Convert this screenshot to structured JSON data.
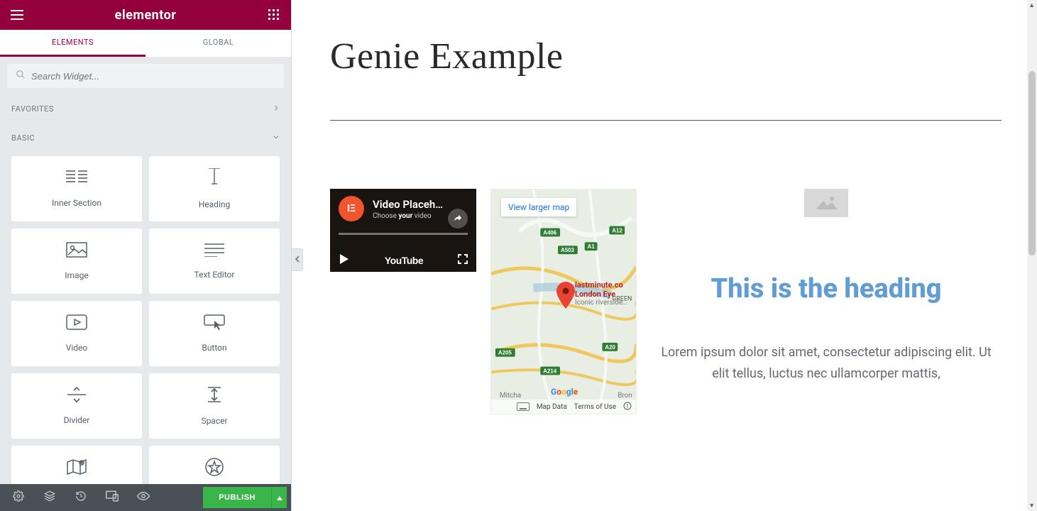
{
  "brand": "elementor",
  "tabs": {
    "elements": "ELEMENTS",
    "global": "GLOBAL"
  },
  "search": {
    "placeholder": "Search Widget..."
  },
  "sections": {
    "favorites": "FAVORITES",
    "basic": "BASIC"
  },
  "widgets": [
    {
      "name": "inner-section",
      "label": "Inner Section"
    },
    {
      "name": "heading",
      "label": "Heading"
    },
    {
      "name": "image",
      "label": "Image"
    },
    {
      "name": "text-editor",
      "label": "Text Editor"
    },
    {
      "name": "video",
      "label": "Video"
    },
    {
      "name": "button",
      "label": "Button"
    },
    {
      "name": "divider",
      "label": "Divider"
    },
    {
      "name": "spacer",
      "label": "Spacer"
    },
    {
      "name": "google-maps",
      "label": ""
    },
    {
      "name": "star-rating",
      "label": ""
    }
  ],
  "footer": {
    "publish": "PUBLISH"
  },
  "canvas": {
    "title": "Genie Example",
    "video": {
      "title": "Video Placeh…",
      "sub_prefix": "Choose ",
      "sub_bold": "your",
      "sub_suffix": " video",
      "youtube": "YouTube"
    },
    "map": {
      "larger": "View larger map",
      "place_line1": "lastminute.co",
      "place_line2": "London Eye",
      "place_sub": "Iconic riverside…",
      "roads": [
        "A406",
        "A12",
        "A503",
        "A1",
        "A205",
        "A214",
        "A20"
      ],
      "places": [
        "Mitcha",
        "Bron",
        "GREEN"
      ],
      "google": "Google",
      "mapdata": "Map Data",
      "terms": "Terms of Use"
    },
    "right": {
      "heading": "This is the heading",
      "para": "Lorem ipsum dolor sit amet, consectetur adipiscing elit. Ut elit tellus, luctus nec ullamcorper mattis,"
    }
  }
}
